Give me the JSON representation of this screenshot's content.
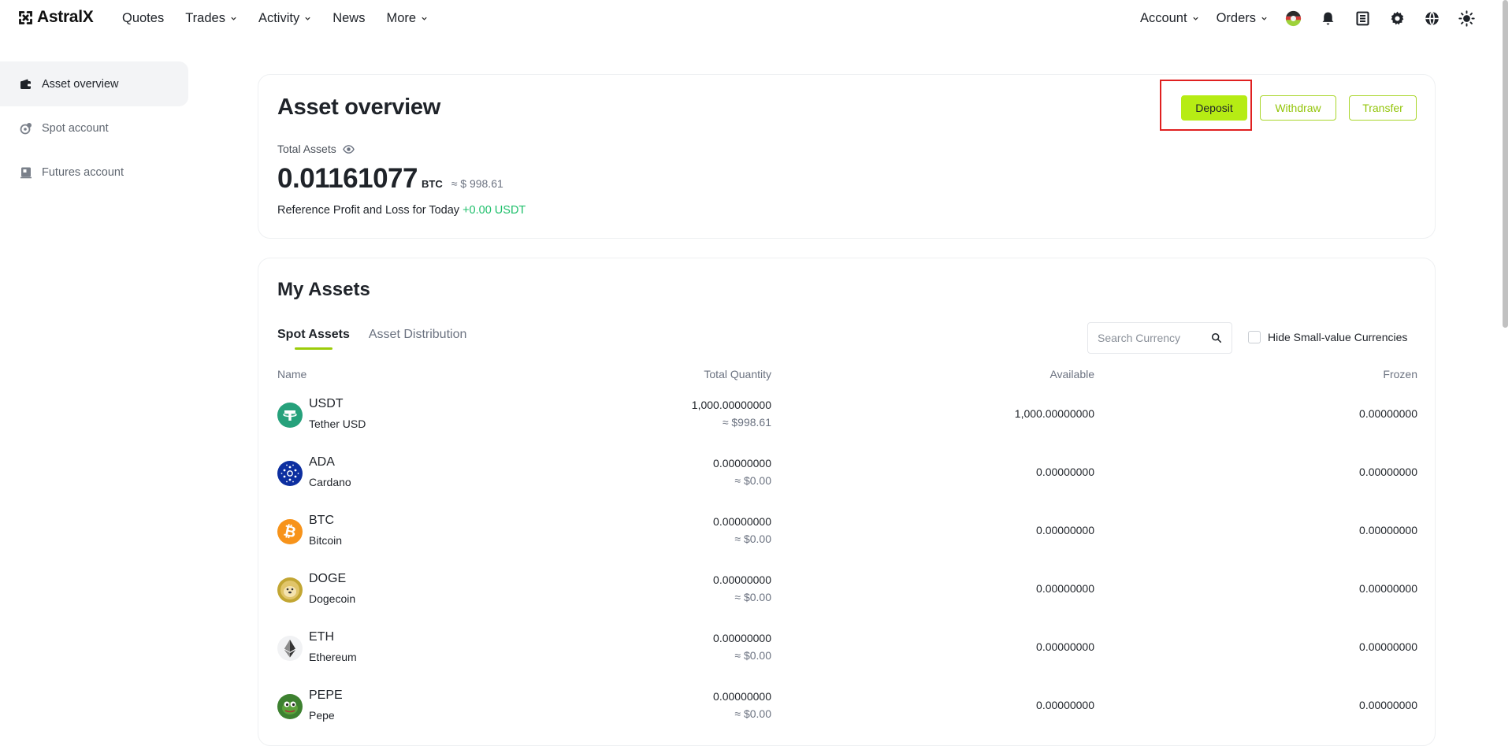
{
  "brand": {
    "name": "AstralX"
  },
  "nav": {
    "left": [
      {
        "label": "Quotes",
        "dropdown": false
      },
      {
        "label": "Trades",
        "dropdown": true
      },
      {
        "label": "Activity",
        "dropdown": true
      },
      {
        "label": "News",
        "dropdown": false
      },
      {
        "label": "More",
        "dropdown": true
      }
    ],
    "account_label": "Account",
    "orders_label": "Orders",
    "icons": [
      "avatar-flag",
      "bell-icon",
      "download-app-icon",
      "settings-icon",
      "globe-icon",
      "theme-sun-icon"
    ]
  },
  "sidebar": {
    "items": [
      {
        "label": "Asset overview",
        "icon": "wallet-icon",
        "active": true
      },
      {
        "label": "Spot account",
        "icon": "spot-icon",
        "active": false
      },
      {
        "label": "Futures account",
        "icon": "futures-icon",
        "active": false
      }
    ]
  },
  "overview": {
    "title": "Asset overview",
    "total_label": "Total Assets",
    "total_value": "0.01161077",
    "total_unit": "BTC",
    "total_approx": "≈ $ 998.61",
    "pnl_label": "Reference Profit and Loss for Today",
    "pnl_value": "+0.00 USDT",
    "buttons": {
      "deposit": "Deposit",
      "withdraw": "Withdraw",
      "transfer": "Transfer"
    }
  },
  "assets": {
    "title": "My Assets",
    "tabs": [
      {
        "label": "Spot Assets",
        "active": true
      },
      {
        "label": "Asset Distribution",
        "active": false
      }
    ],
    "search_placeholder": "Search Currency",
    "hide_small_label": "Hide Small-value Currencies",
    "columns": {
      "name": "Name",
      "total_quantity": "Total Quantity",
      "available": "Available",
      "frozen": "Frozen"
    },
    "rows": [
      {
        "symbol": "USDT",
        "name": "Tether USD",
        "qty": "1,000.00000000",
        "qty_usd": "≈ $998.61",
        "available": "1,000.00000000",
        "frozen": "0.00000000"
      },
      {
        "symbol": "ADA",
        "name": "Cardano",
        "qty": "0.00000000",
        "qty_usd": "≈ $0.00",
        "available": "0.00000000",
        "frozen": "0.00000000"
      },
      {
        "symbol": "BTC",
        "name": "Bitcoin",
        "qty": "0.00000000",
        "qty_usd": "≈ $0.00",
        "available": "0.00000000",
        "frozen": "0.00000000"
      },
      {
        "symbol": "DOGE",
        "name": "Dogecoin",
        "qty": "0.00000000",
        "qty_usd": "≈ $0.00",
        "available": "0.00000000",
        "frozen": "0.00000000"
      },
      {
        "symbol": "ETH",
        "name": "Ethereum",
        "qty": "0.00000000",
        "qty_usd": "≈ $0.00",
        "available": "0.00000000",
        "frozen": "0.00000000"
      },
      {
        "symbol": "PEPE",
        "name": "Pepe",
        "qty": "0.00000000",
        "qty_usd": "≈ $0.00",
        "available": "0.00000000",
        "frozen": "0.00000000"
      }
    ]
  },
  "colors": {
    "accent": "#b6ec14",
    "accent_text": "#93c50a",
    "positive": "#1dbf6a",
    "highlight_box": "#e02020"
  }
}
